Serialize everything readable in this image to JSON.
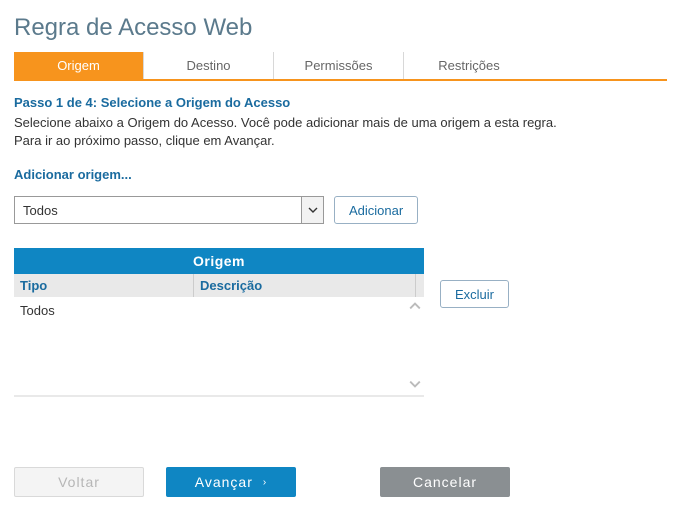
{
  "title": "Regra de Acesso Web",
  "tabs": [
    {
      "label": "Origem",
      "active": true
    },
    {
      "label": "Destino",
      "active": false
    },
    {
      "label": "Permissões",
      "active": false
    },
    {
      "label": "Restrições",
      "active": false
    }
  ],
  "step": {
    "heading": "Passo 1 de 4: Selecione a Origem do Acesso",
    "desc_line1": "Selecione abaixo a Origem do Acesso. Você pode adicionar mais de uma origem a esta regra.",
    "desc_line2": "Para ir ao próximo passo, clique em Avançar."
  },
  "add_origin_label": "Adicionar origem...",
  "origin_select": {
    "value": "Todos"
  },
  "buttons": {
    "adicionar": "Adicionar",
    "excluir": "Excluir",
    "voltar": "Voltar",
    "avancar": "Avançar",
    "cancelar": "Cancelar"
  },
  "table": {
    "title": "Origem",
    "col_tipo": "Tipo",
    "col_descricao": "Descrição",
    "rows": [
      {
        "tipo": "Todos",
        "descricao": ""
      }
    ]
  }
}
